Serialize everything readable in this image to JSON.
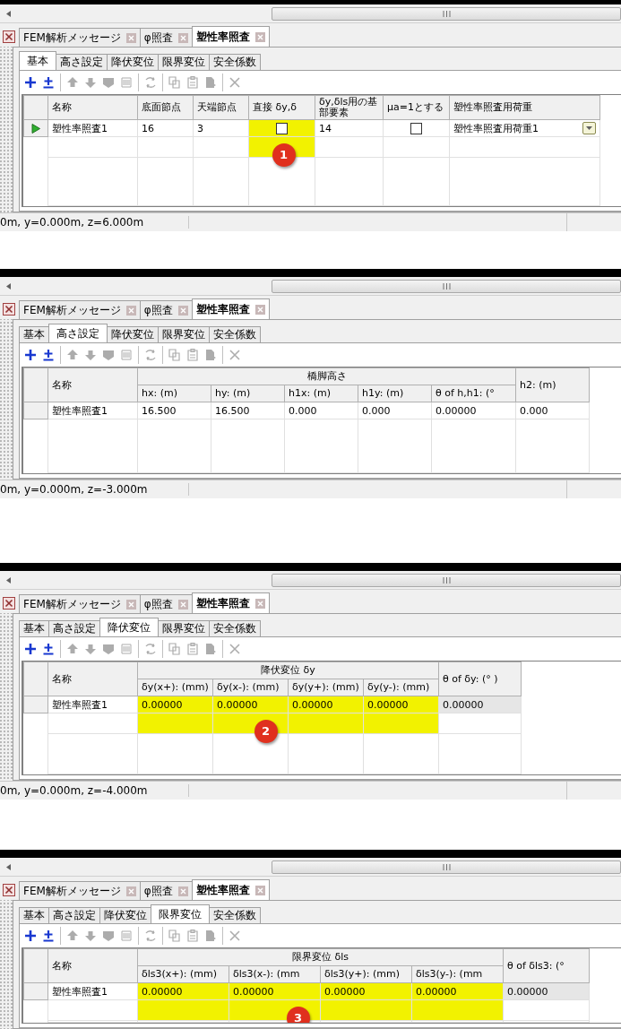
{
  "panels": [
    {
      "doc_tabs": [
        {
          "label": "FEM解析メッセージ",
          "selected": false
        },
        {
          "label": "φ照査",
          "selected": false
        },
        {
          "label": "塑性率照査",
          "selected": true
        }
      ],
      "sub_tabs": [
        {
          "label": "基本",
          "selected": true
        },
        {
          "label": "高さ設定",
          "selected": false
        },
        {
          "label": "降伏変位",
          "selected": false
        },
        {
          "label": "限界変位",
          "selected": false
        },
        {
          "label": "安全係数",
          "selected": false
        }
      ],
      "toolbar": [
        [
          {
            "kind": "add",
            "disabled": false
          },
          {
            "kind": "insert",
            "disabled": false
          }
        ],
        [
          {
            "kind": "move_up",
            "disabled": true
          },
          {
            "kind": "move_down",
            "disabled": true
          },
          {
            "kind": "block_a",
            "disabled": true
          },
          {
            "kind": "block_b",
            "disabled": true
          }
        ],
        [
          {
            "kind": "sort",
            "disabled": true
          }
        ],
        [
          {
            "kind": "copy",
            "disabled": true
          },
          {
            "kind": "paste",
            "disabled": true
          },
          {
            "kind": "export",
            "disabled": true
          }
        ],
        [
          {
            "kind": "delete",
            "disabled": true
          }
        ]
      ],
      "table": {
        "columns": [
          {
            "label": "名称"
          },
          {
            "label": "底面節点"
          },
          {
            "label": "天端節点"
          },
          {
            "label": "直接 δy,δ"
          },
          {
            "label": "δy,δls用の基部要素"
          },
          {
            "label": "μa=1とする"
          },
          {
            "label": "塑性率照査用荷重"
          }
        ],
        "rows": [
          {
            "current": true,
            "cells": [
              {
                "kind": "text",
                "text": "塑性率照査1",
                "highlighted": false
              },
              {
                "kind": "text",
                "text": "16",
                "highlighted": false
              },
              {
                "kind": "text",
                "text": "3",
                "highlighted": false
              },
              {
                "kind": "checkbox",
                "checked": false,
                "highlighted": true
              },
              {
                "kind": "text",
                "text": "14",
                "highlighted": false
              },
              {
                "kind": "checkbox",
                "checked": false,
                "highlighted": false
              },
              {
                "kind": "dropdown",
                "text": "塑性率照査用荷重1",
                "highlighted": false
              }
            ]
          }
        ]
      },
      "status_bar": "0m, y=0.000m, z=6.000m",
      "callout": {
        "number": "1"
      }
    },
    {
      "doc_tabs": [
        {
          "label": "FEM解析メッセージ",
          "selected": false
        },
        {
          "label": "φ照査",
          "selected": false
        },
        {
          "label": "塑性率照査",
          "selected": true
        }
      ],
      "sub_tabs": [
        {
          "label": "基本",
          "selected": false
        },
        {
          "label": "高さ設定",
          "selected": true
        },
        {
          "label": "降伏変位",
          "selected": false
        },
        {
          "label": "限界変位",
          "selected": false
        },
        {
          "label": "安全係数",
          "selected": false
        }
      ],
      "toolbar": [
        [
          {
            "kind": "add",
            "disabled": false
          },
          {
            "kind": "insert",
            "disabled": false
          }
        ],
        [
          {
            "kind": "move_up",
            "disabled": true
          },
          {
            "kind": "move_down",
            "disabled": true
          },
          {
            "kind": "block_a",
            "disabled": true
          },
          {
            "kind": "block_b",
            "disabled": true
          }
        ],
        [
          {
            "kind": "sort",
            "disabled": true
          }
        ],
        [
          {
            "kind": "copy",
            "disabled": true
          },
          {
            "kind": "paste",
            "disabled": true
          },
          {
            "kind": "export",
            "disabled": true
          }
        ],
        [
          {
            "kind": "delete",
            "disabled": true
          }
        ]
      ],
      "table": {
        "columns": [
          {
            "label": "名称"
          },
          {
            "label": "橋脚高さ",
            "colspan": 5,
            "children": [
              {
                "label": "hx: (m)"
              },
              {
                "label": "hy: (m)"
              },
              {
                "label": "h1x: (m)"
              },
              {
                "label": "h1y: (m)"
              },
              {
                "label": "θ of h,h1: (°"
              }
            ]
          },
          {
            "label": "h2: (m)"
          }
        ],
        "rows": [
          {
            "current": false,
            "cells": [
              {
                "kind": "text",
                "text": "塑性率照査1",
                "highlighted": false
              },
              {
                "kind": "text",
                "text": "16.500",
                "highlighted": false
              },
              {
                "kind": "text",
                "text": "16.500",
                "highlighted": false
              },
              {
                "kind": "text",
                "text": "0.000",
                "highlighted": false
              },
              {
                "kind": "text",
                "text": "0.000",
                "highlighted": false
              },
              {
                "kind": "text",
                "text": "0.00000",
                "highlighted": false
              },
              {
                "kind": "text",
                "text": "0.000",
                "highlighted": false
              }
            ]
          }
        ]
      },
      "status_bar": "0m, y=0.000m, z=-3.000m"
    },
    {
      "doc_tabs": [
        {
          "label": "FEM解析メッセージ",
          "selected": false
        },
        {
          "label": "φ照査",
          "selected": false
        },
        {
          "label": "塑性率照査",
          "selected": true
        }
      ],
      "sub_tabs": [
        {
          "label": "基本",
          "selected": false
        },
        {
          "label": "高さ設定",
          "selected": false
        },
        {
          "label": "降伏変位",
          "selected": true
        },
        {
          "label": "限界変位",
          "selected": false
        },
        {
          "label": "安全係数",
          "selected": false
        }
      ],
      "toolbar": [
        [
          {
            "kind": "add",
            "disabled": false
          },
          {
            "kind": "insert",
            "disabled": false
          }
        ],
        [
          {
            "kind": "move_up",
            "disabled": true
          },
          {
            "kind": "move_down",
            "disabled": true
          },
          {
            "kind": "block_a",
            "disabled": true
          },
          {
            "kind": "block_b",
            "disabled": true
          }
        ],
        [
          {
            "kind": "sort",
            "disabled": true
          }
        ],
        [
          {
            "kind": "copy",
            "disabled": true
          },
          {
            "kind": "paste",
            "disabled": true
          },
          {
            "kind": "export",
            "disabled": true
          }
        ],
        [
          {
            "kind": "delete",
            "disabled": true
          }
        ]
      ],
      "table": {
        "columns": [
          {
            "label": "名称"
          },
          {
            "label": "降伏変位 δy",
            "colspan": 4,
            "children": [
              {
                "label": "δy(x+): (mm)"
              },
              {
                "label": "δy(x-): (mm)"
              },
              {
                "label": "δy(y+): (mm)"
              },
              {
                "label": "δy(y-): (mm)"
              }
            ]
          },
          {
            "label": "θ of δy: (° )"
          }
        ],
        "rows": [
          {
            "current": false,
            "cells": [
              {
                "kind": "text",
                "text": "塑性率照査1",
                "highlighted": false
              },
              {
                "kind": "text",
                "text": "0.00000",
                "highlighted": true
              },
              {
                "kind": "text",
                "text": "0.00000",
                "highlighted": true
              },
              {
                "kind": "text",
                "text": "0.00000",
                "highlighted": true
              },
              {
                "kind": "text",
                "text": "0.00000",
                "highlighted": true
              },
              {
                "kind": "readonly",
                "text": "0.00000",
                "highlighted": false
              }
            ]
          }
        ]
      },
      "status_bar": "0m, y=0.000m, z=-4.000m",
      "callout": {
        "number": "2"
      }
    },
    {
      "doc_tabs": [
        {
          "label": "FEM解析メッセージ",
          "selected": false
        },
        {
          "label": "φ照査",
          "selected": false
        },
        {
          "label": "塑性率照査",
          "selected": true
        }
      ],
      "sub_tabs": [
        {
          "label": "基本",
          "selected": false
        },
        {
          "label": "高さ設定",
          "selected": false
        },
        {
          "label": "降伏変位",
          "selected": false
        },
        {
          "label": "限界変位",
          "selected": true
        },
        {
          "label": "安全係数",
          "selected": false
        }
      ],
      "toolbar": [
        [
          {
            "kind": "add",
            "disabled": false
          },
          {
            "kind": "insert",
            "disabled": false
          }
        ],
        [
          {
            "kind": "move_up",
            "disabled": true
          },
          {
            "kind": "move_down",
            "disabled": true
          },
          {
            "kind": "block_a",
            "disabled": true
          },
          {
            "kind": "block_b",
            "disabled": true
          }
        ],
        [
          {
            "kind": "sort",
            "disabled": true
          }
        ],
        [
          {
            "kind": "copy",
            "disabled": true
          },
          {
            "kind": "paste",
            "disabled": true
          },
          {
            "kind": "export",
            "disabled": true
          }
        ],
        [
          {
            "kind": "delete",
            "disabled": true
          }
        ]
      ],
      "table": {
        "columns": [
          {
            "label": "名称"
          },
          {
            "label": "限界変位 δls",
            "colspan": 4,
            "children": [
              {
                "label": "δls3(x+): (mm)"
              },
              {
                "label": "δls3(x-): (mm"
              },
              {
                "label": "δls3(y+): (mm)"
              },
              {
                "label": "δls3(y-): (mm"
              }
            ]
          },
          {
            "label": "θ of δls3: (°"
          }
        ],
        "rows": [
          {
            "current": false,
            "cells": [
              {
                "kind": "text",
                "text": "塑性率照査1",
                "highlighted": false
              },
              {
                "kind": "text",
                "text": "0.00000",
                "highlighted": true
              },
              {
                "kind": "text",
                "text": "0.00000",
                "highlighted": true
              },
              {
                "kind": "text",
                "text": "0.00000",
                "highlighted": true
              },
              {
                "kind": "text",
                "text": "0.00000",
                "highlighted": true
              },
              {
                "kind": "readonly",
                "text": "0.00000",
                "highlighted": false
              }
            ]
          }
        ]
      },
      "callout": {
        "number": "3"
      }
    }
  ]
}
